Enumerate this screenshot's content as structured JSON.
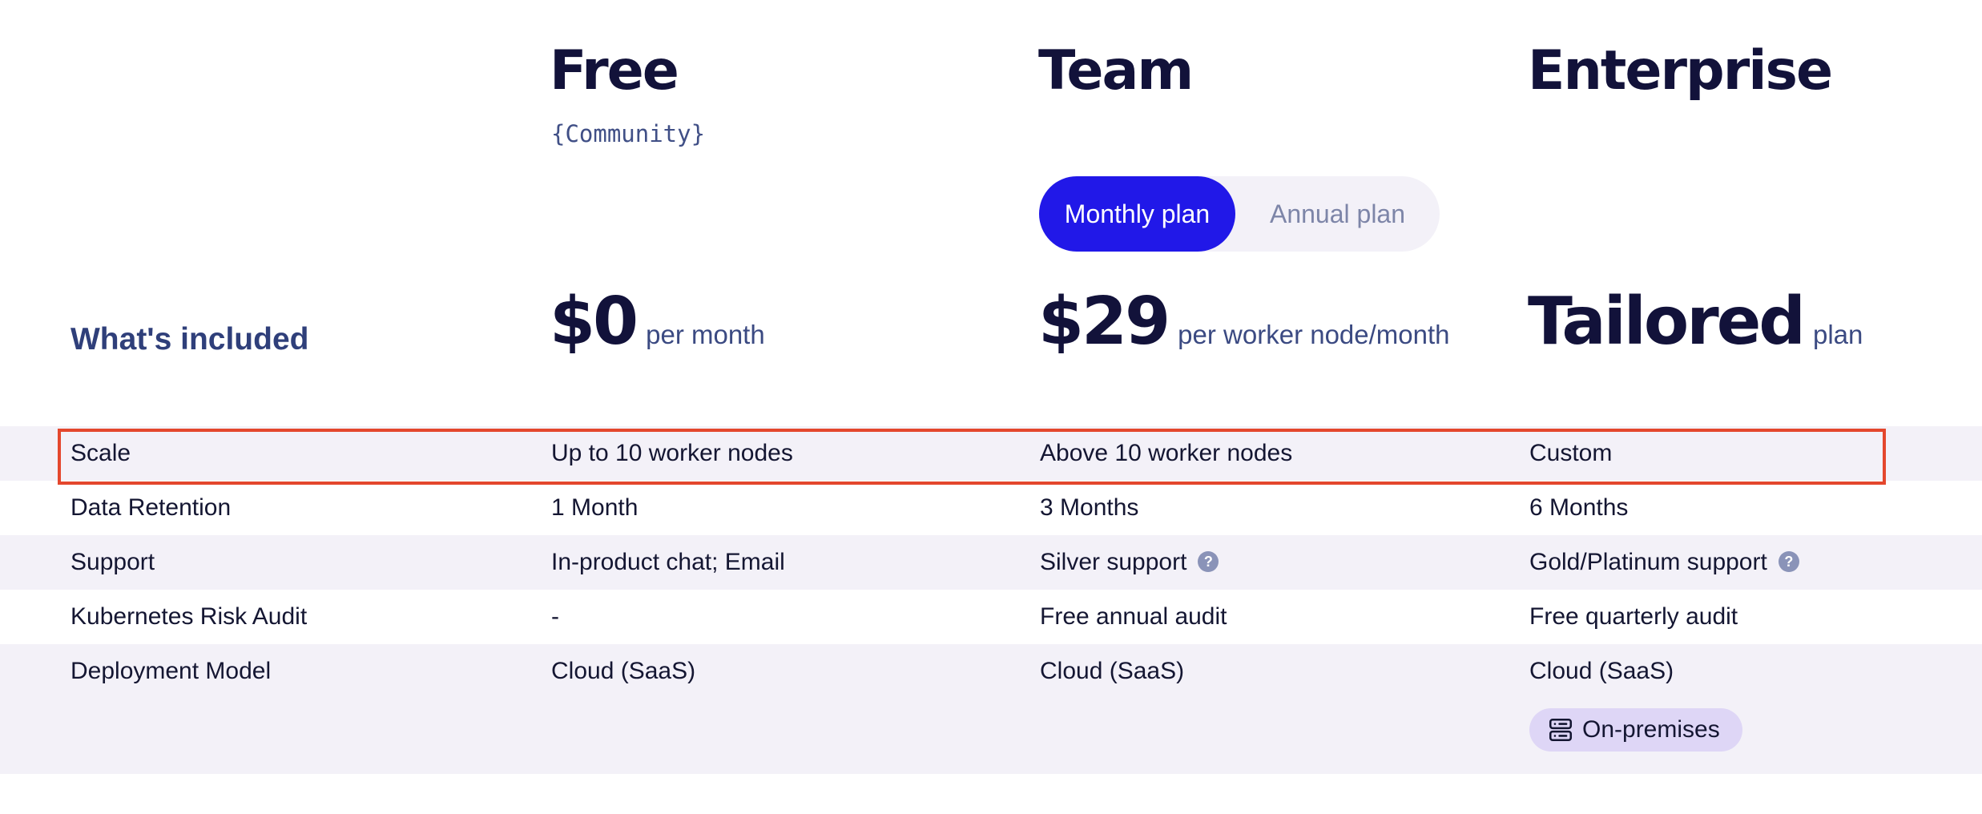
{
  "plans": {
    "free": {
      "name": "Free",
      "subtitle": "{Community}",
      "price": "$0",
      "unit": "per month"
    },
    "team": {
      "name": "Team",
      "price": "$29",
      "unit": "per worker node/month"
    },
    "enterprise": {
      "name": "Enterprise",
      "price": "Tailored",
      "unit": "plan"
    }
  },
  "billing_toggle": {
    "active": "Monthly plan",
    "inactive": "Annual plan"
  },
  "included_heading": "What's included",
  "rows": [
    {
      "label": "Scale",
      "free": "Up to 10 worker nodes",
      "team": "Above 10 worker nodes",
      "enterprise": "Custom"
    },
    {
      "label": "Data Retention",
      "free": "1 Month",
      "team": "3 Months",
      "enterprise": "6 Months"
    },
    {
      "label": "Support",
      "free": "In-product chat; Email",
      "team": "Silver support",
      "enterprise": "Gold/Platinum support"
    },
    {
      "label": "Kubernetes Risk Audit",
      "free": "-",
      "team": "Free annual audit",
      "enterprise": "Free quarterly audit"
    },
    {
      "label": "Deployment Model",
      "free": "Cloud (SaaS)",
      "team": "Cloud (SaaS)",
      "enterprise": "Cloud (SaaS)"
    }
  ],
  "help_glyph": "?",
  "on_premises_badge": {
    "label": "On-premises",
    "icon": "server-icon"
  },
  "colors": {
    "accent": "#2118e8",
    "heading": "#12123a",
    "row_shade": "#f3f1f8",
    "badge_bg": "#ded6f6",
    "highlight_border": "#e4472d"
  }
}
